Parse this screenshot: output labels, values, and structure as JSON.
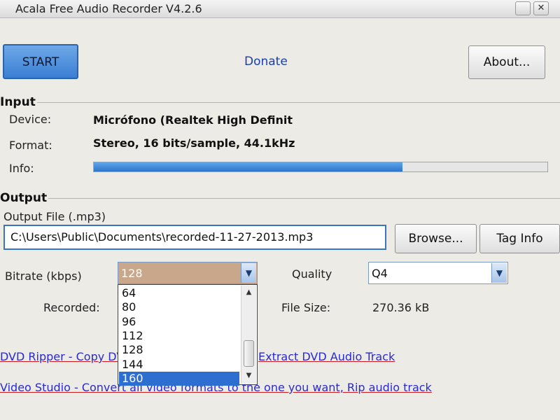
{
  "window": {
    "title": "Acala Free Audio Recorder V4.2.6",
    "close_glyph": "✕"
  },
  "toolbar": {
    "start_label": "START",
    "donate_label": "Donate",
    "about_label": "About..."
  },
  "input_group": {
    "label": "Input",
    "device_label": "Device:",
    "device_value": "Micrófono (Realtek High Definit",
    "format_label": "Format:",
    "format_value": "Stereo, 16 bits/sample, 44.1kHz",
    "info_label": "Info:",
    "info_level_fraction": 0.68
  },
  "output_group": {
    "label": "Output",
    "file_label": "Output File (.mp3)",
    "file_value": "C:\\Users\\Public\\Documents\\recorded-11-27-2013.mp3",
    "browse_label": "Browse...",
    "tag_info_label": "Tag Info",
    "bitrate_label": "Bitrate (kbps)",
    "bitrate_selected": "128",
    "bitrate_options_visible": [
      "64",
      "80",
      "96",
      "112",
      "128",
      "144",
      "160"
    ],
    "bitrate_highlighted": "160",
    "quality_label": "Quality",
    "quality_value": "Q4",
    "recorded_label": "Recorded:",
    "filesize_label": "File Size:",
    "filesize_value": "270.36 kB"
  },
  "ads": {
    "dvd_ripper_left": "DVD Ripper - Copy DV",
    "dvd_ripper_right": "Extract DVD Audio Track",
    "video_studio": "Video Studio - Convert all video formats to the one you want, Rip audio track"
  },
  "colors": {
    "accent": "#2d6fd1",
    "link": "#2a2ad0",
    "link_underline": "#d01818"
  }
}
